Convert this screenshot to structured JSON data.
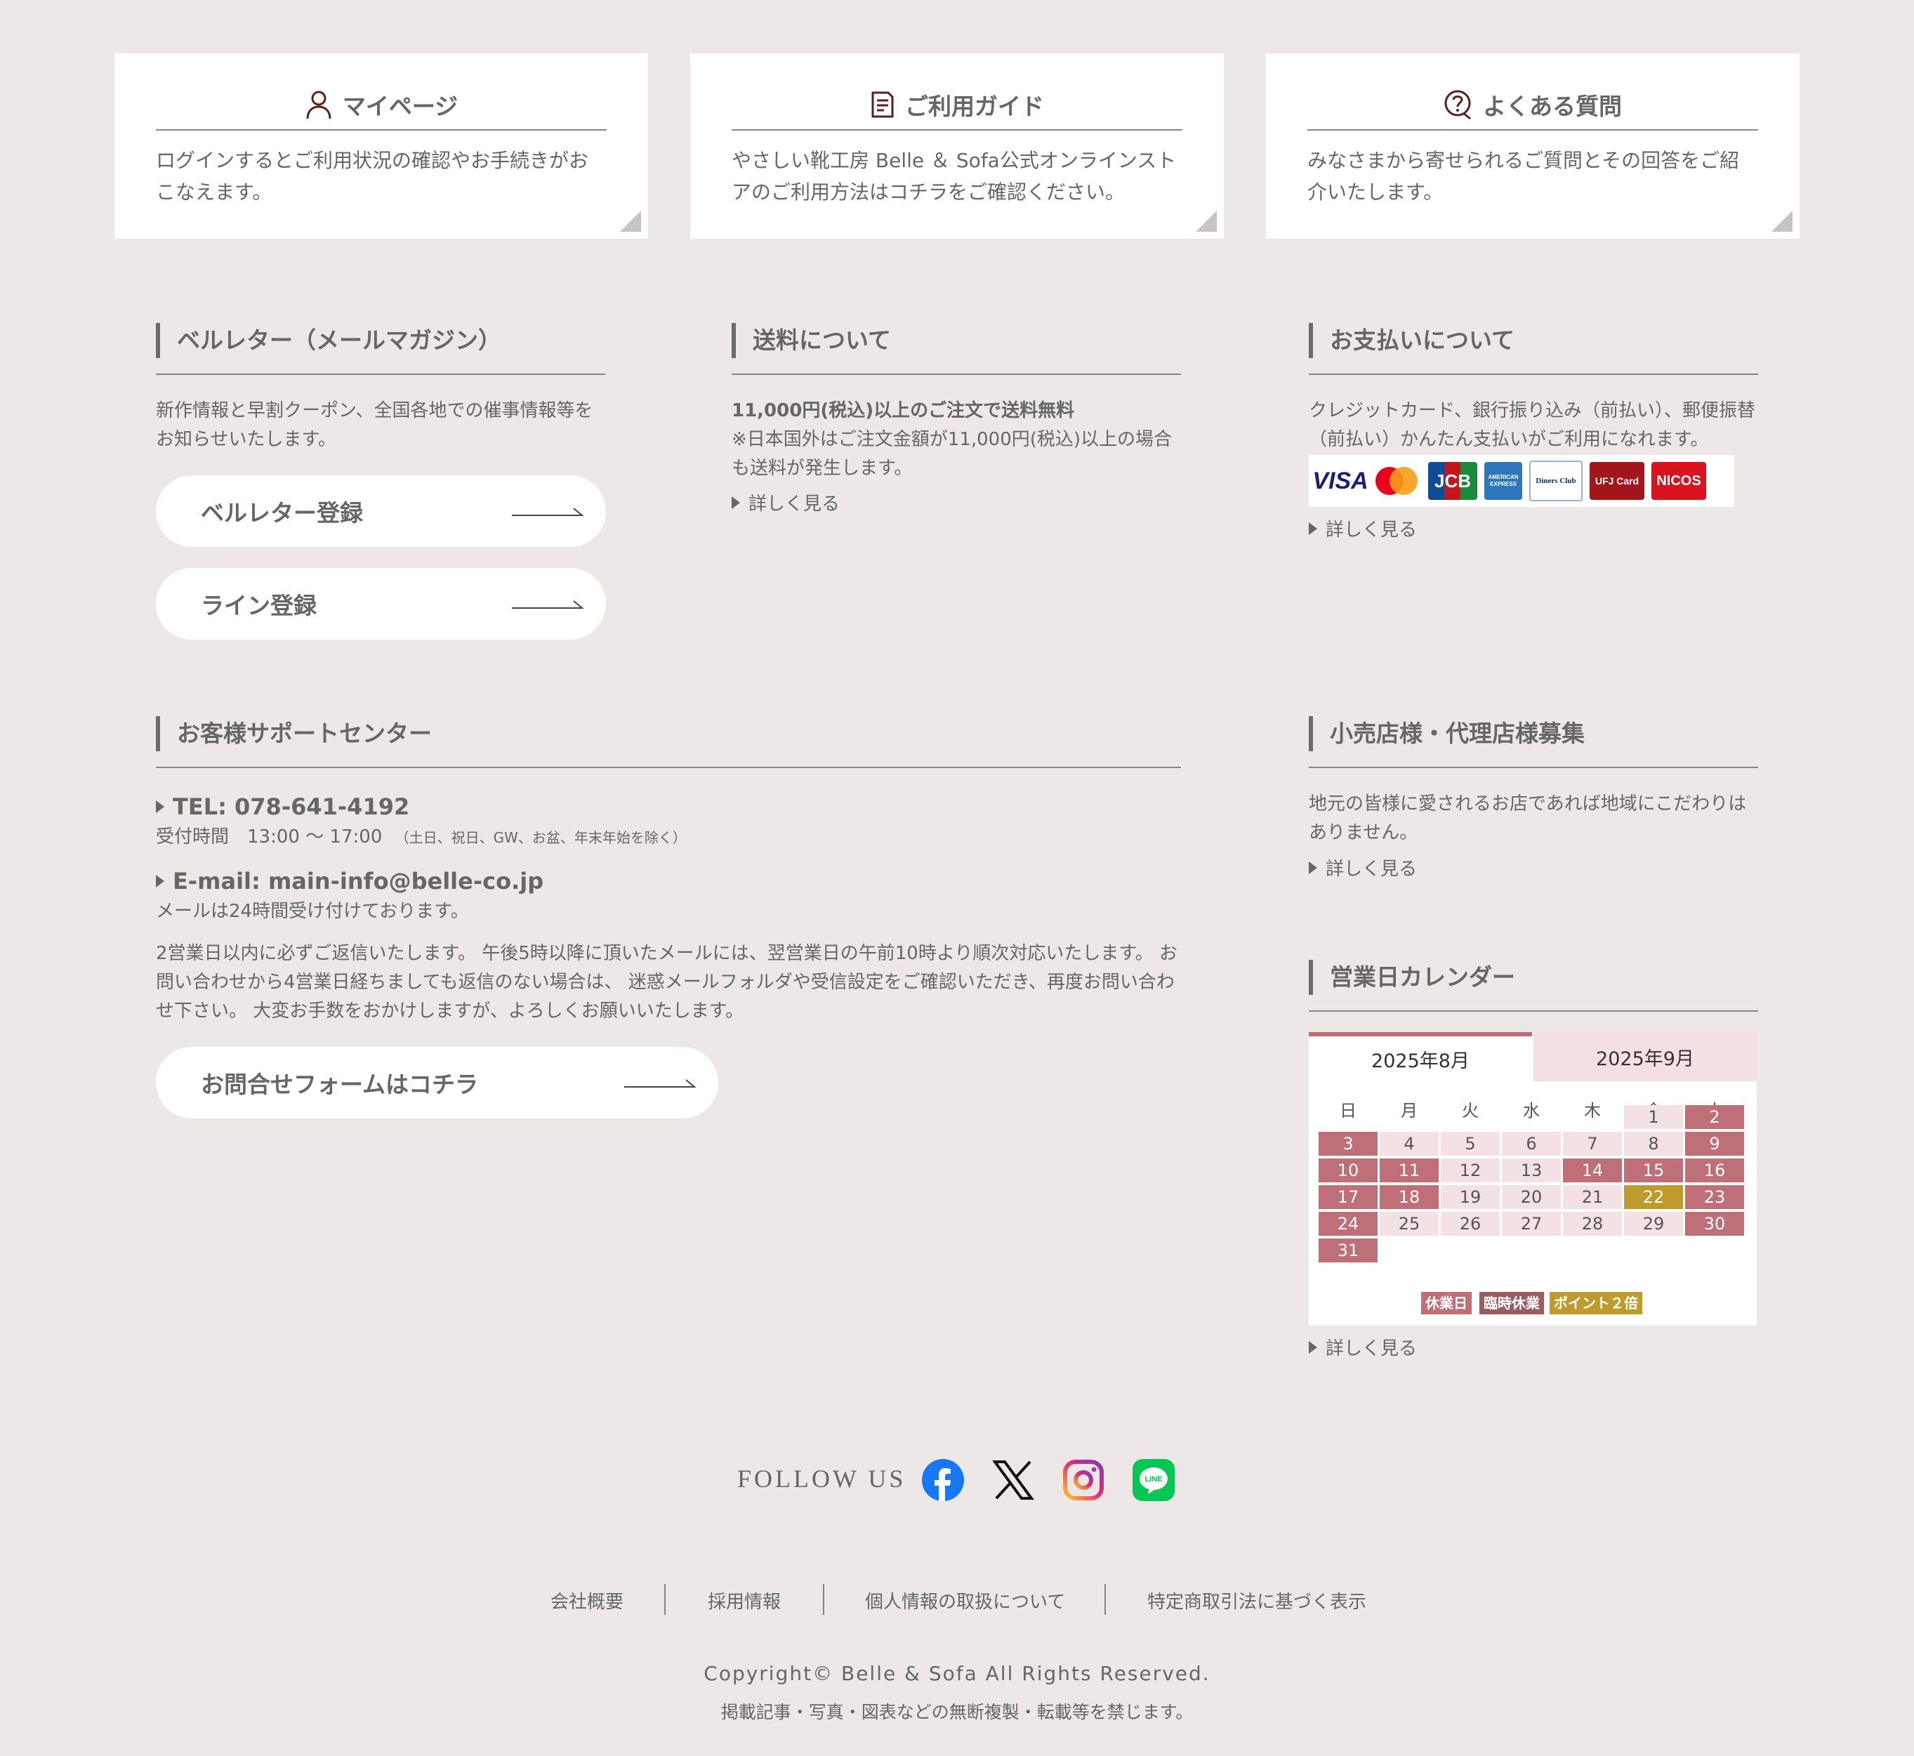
{
  "cards": [
    {
      "title": "マイページ",
      "text": "ログインするとご利用状況の確認やお手続きがおこなえます。",
      "icon": "user-icon"
    },
    {
      "title": "ご利用ガイド",
      "text": "やさしい靴工房 Belle ＆ Sofa公式オンラインストアのご利用方法はコチラをご確認ください。",
      "icon": "document-icon"
    },
    {
      "title": "よくある質問",
      "text": "みなさまから寄せられるご質問とその回答をご紹介いたします。",
      "icon": "question-icon"
    }
  ],
  "newsletter": {
    "heading": "ベルレター（メールマガジン）",
    "text": "新作情報と早割クーポン、全国各地での催事情報等をお知らせいたします。",
    "button1": "ベルレター登録",
    "button2": "ライン登録"
  },
  "shipping": {
    "heading": "送料について",
    "bold": "11,000円(税込)以上のご注文で送料無料",
    "text": "※日本国外はご注文金額が11,000円(税込)以上の場合も送料が発生します。",
    "more": "詳しく見る"
  },
  "payment": {
    "heading": "お支払いについて",
    "text": "クレジットカード、銀行振り込み（前払い）、郵便振替（前払い）かんたん支払いがご利用になれます。",
    "cards": [
      "VISA",
      "Mastercard",
      "JCB",
      "AMERICAN EXPRESS",
      "Diners Club",
      "UFJ Card",
      "NICOS"
    ],
    "more": "詳しく見る"
  },
  "support": {
    "heading": "お客様サポートセンター",
    "tel": "TEL: 078-641-4192",
    "hours": "受付時間　13:00 〜 17:00",
    "hours_note": "（土日、祝日、GW、お盆、年末年始を除く）",
    "email": "E-mail: main-info@belle-co.jp",
    "email_note": "メールは24時間受け付けております。",
    "text": "2営業日以内に必ずご返信いたします。 午後5時以降に頂いたメールには、翌営業日の午前10時より順次対応いたします。 お問い合わせから4営業日経ちましても返信のない場合は、 迷惑メールフォルダや受信設定をご確認いただき、再度お問い合わせ下さい。 大変お手数をおかけしますが、よろしくお願いいたします。",
    "button": "お問合せフォームはコチラ"
  },
  "retail": {
    "heading": "小売店様・代理店様募集",
    "text": "地元の皆様に愛されるお店であれば地域にこだわりはありません。",
    "more": "詳しく見る"
  },
  "calendar": {
    "heading": "営業日カレンダー",
    "tab_active": "2025年8月",
    "tab_inactive": "2025年9月",
    "weekdays": [
      "日",
      "月",
      "火",
      "水",
      "木",
      "金",
      "土"
    ],
    "days": [
      {
        "d": "1",
        "t": "n"
      },
      {
        "d": "2",
        "t": "o"
      },
      {
        "d": "3",
        "t": "o"
      },
      {
        "d": "4",
        "t": "n"
      },
      {
        "d": "5",
        "t": "n"
      },
      {
        "d": "6",
        "t": "n"
      },
      {
        "d": "7",
        "t": "n"
      },
      {
        "d": "8",
        "t": "n"
      },
      {
        "d": "9",
        "t": "o"
      },
      {
        "d": "10",
        "t": "o"
      },
      {
        "d": "11",
        "t": "o"
      },
      {
        "d": "12",
        "t": "n"
      },
      {
        "d": "13",
        "t": "n"
      },
      {
        "d": "14",
        "t": "o"
      },
      {
        "d": "15",
        "t": "o"
      },
      {
        "d": "16",
        "t": "o"
      },
      {
        "d": "17",
        "t": "o"
      },
      {
        "d": "18",
        "t": "o"
      },
      {
        "d": "19",
        "t": "n"
      },
      {
        "d": "20",
        "t": "n"
      },
      {
        "d": "21",
        "t": "n"
      },
      {
        "d": "22",
        "t": "g"
      },
      {
        "d": "23",
        "t": "o"
      },
      {
        "d": "24",
        "t": "o"
      },
      {
        "d": "25",
        "t": "n"
      },
      {
        "d": "26",
        "t": "n"
      },
      {
        "d": "27",
        "t": "n"
      },
      {
        "d": "28",
        "t": "n"
      },
      {
        "d": "29",
        "t": "n"
      },
      {
        "d": "30",
        "t": "o"
      },
      {
        "d": "31",
        "t": "o"
      }
    ],
    "first_weekday": 5,
    "legend": [
      "休業日",
      "臨時休業",
      "ポイント２倍"
    ],
    "more": "詳しく見る",
    "colors": {
      "closed": "#be6f77",
      "temp": "#9a5c63",
      "points": "#bf9a2d"
    }
  },
  "follow": {
    "label": "FOLLOW US",
    "icons": [
      "facebook-icon",
      "x-icon",
      "instagram-icon",
      "line-icon"
    ]
  },
  "footer": {
    "links": [
      "会社概要",
      "採用情報",
      "個人情報の取扱について",
      "特定商取引法に基づく表示"
    ],
    "copyright": "Copyright© Belle & Sofa All Rights Reserved.",
    "notice": "掲載記事・写真・図表などの無断複製・転載等を禁じます。"
  }
}
